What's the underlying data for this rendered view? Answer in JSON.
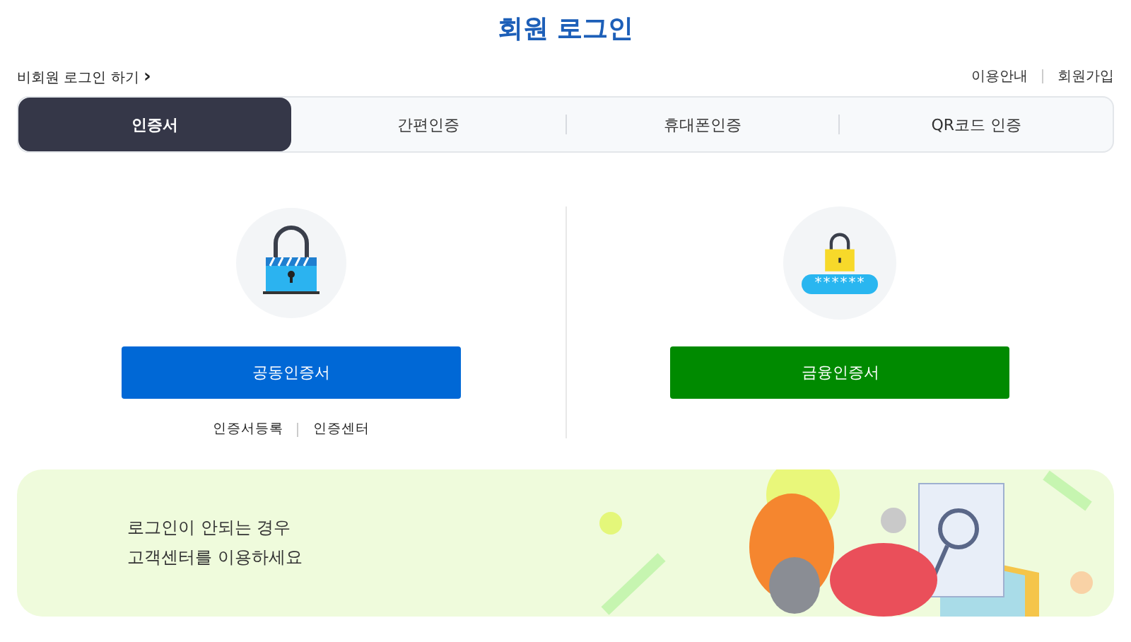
{
  "title": "회원 로그인",
  "guest_login": {
    "label": "비회원 로그인 하기",
    "arrow": "›"
  },
  "top_links": [
    "이용안내",
    "회원가입"
  ],
  "tabs": [
    {
      "label": "인증서",
      "selected": true
    },
    {
      "label": "간편인증",
      "selected": false
    },
    {
      "label": "휴대폰인증",
      "selected": false
    },
    {
      "label": "QR코드 인증",
      "selected": false
    }
  ],
  "panels": [
    {
      "kind": "joint",
      "button": "공동인증서",
      "links": [
        "인증서등록",
        "인증센터"
      ]
    },
    {
      "kind": "financial",
      "button": "금융인증서",
      "password_mask": "******"
    }
  ],
  "banner": {
    "lines": [
      "로그인이 안되는 경우",
      "고객센터를 이용하세요"
    ]
  }
}
